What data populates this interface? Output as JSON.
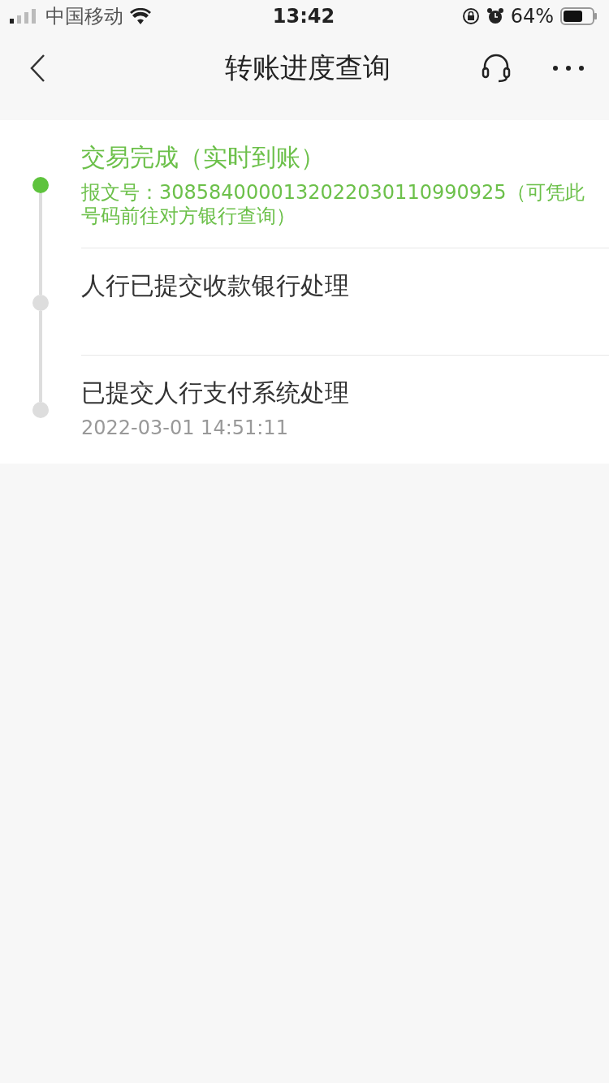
{
  "status_bar": {
    "carrier": "中国移动",
    "time": "13:42",
    "battery": "64%"
  },
  "nav": {
    "title": "转账进度查询"
  },
  "steps": [
    {
      "title": "交易完成（实时到账）",
      "detail": "报文号：3085840000132022030110990925（可凭此号码前往对方银行查询）",
      "active": true
    },
    {
      "title": "人行已提交收款银行处理",
      "active": false
    },
    {
      "title": "已提交人行支付系统处理",
      "detail": "2022-03-01 14:51:11",
      "active": false
    }
  ]
}
